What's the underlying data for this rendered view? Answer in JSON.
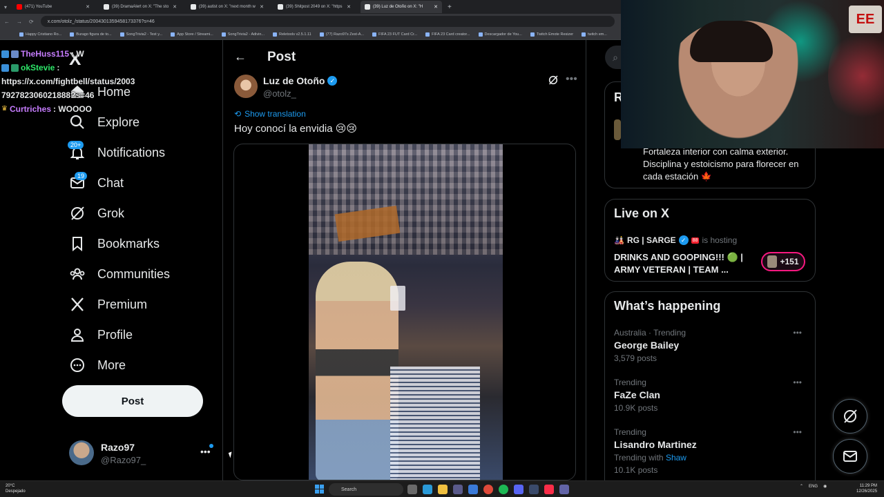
{
  "browser": {
    "tabs": [
      {
        "label": "(471) YouTube",
        "color": "#ff0000"
      },
      {
        "label": "(39) DramaAlert on X: \"The sto",
        "color": "#e7e9ea"
      },
      {
        "label": "(39) autist on X: \"next month w",
        "color": "#e7e9ea"
      },
      {
        "label": "(39) Shitpost 2049 on X: \"https",
        "color": "#e7e9ea"
      },
      {
        "label": "(39) Luz de Otoño on X: \"H",
        "color": "#e7e9ea"
      }
    ],
    "url": "x.com/otolz_/status/2004301359458173376?s=46",
    "bookmarks": [
      "Happy Cristiano Ro...",
      "Burago figura de to...",
      "SongTrivia2 - Test y...",
      "App Store / Streami...",
      "SongTrivia2 - Adivin...",
      "Reletools v2.5.1.11",
      "(77) Razo97s Zest-A...",
      "FIFA 23 FUT Card Cr...",
      "FIFA 23 Card creator...",
      "Descargador de You...",
      "Twitch Emote Resizer",
      "twitch em..."
    ]
  },
  "chat": {
    "line1_name": "TheHuss115",
    "line1_msg": ": W",
    "line2_name": "okStevie",
    "line2_msg": ":",
    "line3": "https://x.com/fightbell/status/2003",
    "line4": "792782306021888?s=46",
    "line5_name": "Curtriches",
    "line5_msg": ": WOOOO"
  },
  "nav": {
    "logo": "X",
    "items": [
      {
        "label": "Home"
      },
      {
        "label": "Explore"
      },
      {
        "label": "Notifications",
        "badge": "20+"
      },
      {
        "label": "Chat",
        "badge": "19"
      },
      {
        "label": "Grok"
      },
      {
        "label": "Bookmarks"
      },
      {
        "label": "Communities"
      },
      {
        "label": "Premium"
      },
      {
        "label": "Profile"
      },
      {
        "label": "More"
      }
    ],
    "post_button": "Post",
    "account_name": "Razo97",
    "account_handle": "@Razo97_"
  },
  "post": {
    "header_title": "Post",
    "author_name": "Luz de Otoño",
    "author_handle": "@otolz_",
    "show_translation": "Show translation",
    "text": "Hoy conocí la envidia 😢😢"
  },
  "right": {
    "card1_letter": "R",
    "bio": "Fortaleza interior con calma exterior. Disciplina y estoicismo para florecer en cada estación 🍁",
    "live_title": "Live on X",
    "live_host": "RG | SARGE",
    "live_badge": "88",
    "live_hosting": "is hosting",
    "live_stream_title": "DRINKS AND GOOPING!!! 🟢 | ARMY VETERAN | TEAM ...",
    "live_count": "+151",
    "happening_title": "What’s happening",
    "trends": [
      {
        "meta": "Australia · Trending",
        "title": "George Bailey",
        "count": "3,579 posts"
      },
      {
        "meta": "Trending",
        "title": "FaZe Clan",
        "count": "10.9K posts"
      },
      {
        "meta": "Trending",
        "title": "Lisandro Martinez",
        "sub_prefix": "Trending with",
        "sub_link": "Shaw",
        "count": "10.1K posts"
      }
    ]
  },
  "webcam": {
    "sign": "EE"
  },
  "taskbar": {
    "temp": "20°C",
    "weather": "Despejado",
    "search": "Search",
    "lang": "ENG",
    "time": "11:29 PM",
    "date": "12/26/2025"
  }
}
